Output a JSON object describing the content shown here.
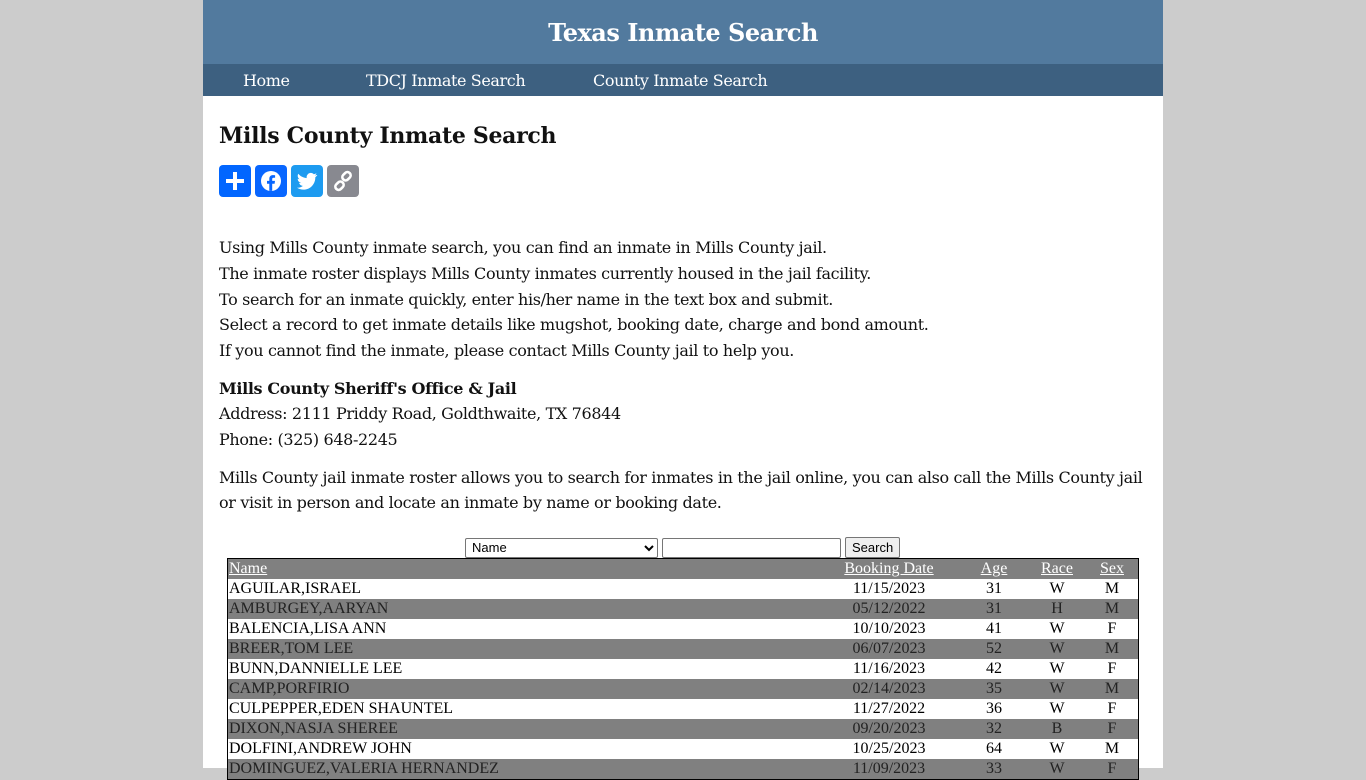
{
  "header": {
    "title": "Texas Inmate Search"
  },
  "nav": {
    "items": [
      {
        "label": "Home"
      },
      {
        "label": "TDCJ Inmate Search"
      },
      {
        "label": "County Inmate Search"
      }
    ]
  },
  "main": {
    "title": "Mills County Inmate Search",
    "share": [
      {
        "name": "share",
        "icon": "plus-icon",
        "color": "#0166ff"
      },
      {
        "name": "facebook",
        "icon": "facebook-icon",
        "color": "#0866ff"
      },
      {
        "name": "twitter",
        "icon": "twitter-icon",
        "color": "#1d9bf0"
      },
      {
        "name": "copy-link",
        "icon": "link-icon",
        "color": "#888990"
      }
    ],
    "intro": [
      "Using Mills County inmate search, you can find an inmate in Mills County jail.",
      "The inmate roster displays Mills County inmates currently housed in the jail facility.",
      "To search for an inmate quickly, enter his/her name in the text box and submit.",
      "Select a record to get inmate details like mugshot, booking date, charge and bond amount.",
      "If you cannot find the inmate, please contact Mills County jail to help you."
    ],
    "office": {
      "name": "Mills County Sheriff's Office & Jail",
      "address": "Address: 2111 Priddy Road, Goldthwaite, TX 76844",
      "phone": "Phone: (325) 648-2245"
    },
    "description": "Mills County jail inmate roster allows you to search for inmates in the jail online, you can also call the Mills County jail or visit in person and locate an inmate by name or booking date."
  },
  "search": {
    "field_selected": "Name",
    "query_value": "",
    "button_label": "Search"
  },
  "roster": {
    "columns": [
      "Name",
      "Booking Date",
      "Age",
      "Race",
      "Sex"
    ],
    "rows": [
      [
        "AGUILAR,ISRAEL",
        "11/15/2023",
        "31",
        "W",
        "M"
      ],
      [
        "AMBURGEY,AARYAN",
        "05/12/2022",
        "31",
        "H",
        "M"
      ],
      [
        "BALENCIA,LISA ANN",
        "10/10/2023",
        "41",
        "W",
        "F"
      ],
      [
        "BREER,TOM LEE",
        "06/07/2023",
        "52",
        "W",
        "M"
      ],
      [
        "BUNN,DANNIELLE LEE",
        "11/16/2023",
        "42",
        "W",
        "F"
      ],
      [
        "CAMP,PORFIRIO",
        "02/14/2023",
        "35",
        "W",
        "M"
      ],
      [
        "CULPEPPER,EDEN SHAUNTEL",
        "11/27/2022",
        "36",
        "W",
        "F"
      ],
      [
        "DIXON,NASJA SHEREE",
        "09/20/2023",
        "32",
        "B",
        "F"
      ],
      [
        "DOLFINI,ANDREW JOHN",
        "10/25/2023",
        "64",
        "W",
        "M"
      ],
      [
        "DOMINGUEZ,VALERIA HERNANDEZ",
        "11/09/2023",
        "33",
        "W",
        "F"
      ]
    ]
  }
}
